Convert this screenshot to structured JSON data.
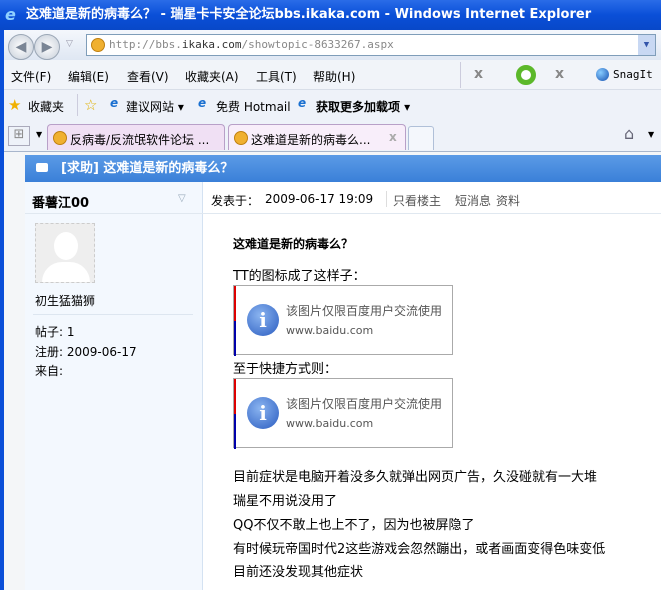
{
  "window": {
    "title": "这难道是新的病毒么？ - 瑞星卡卡安全论坛bbs.ikaka.com - Windows Internet Explorer"
  },
  "address": {
    "prefix": "http://bbs.",
    "domain": "ikaka.com",
    "path": "/showtopic-8633267.aspx"
  },
  "menu": [
    "文件(F)",
    "编辑(E)",
    "查看(V)",
    "收藏夹(A)",
    "工具(T)",
    "帮助(H)"
  ],
  "toolbar": {
    "close1": "x",
    "close2": "x",
    "snagit": "SnagIt"
  },
  "favorites": {
    "label": "收藏夹",
    "items": [
      "建议网站 ▾",
      "免费 Hotmail",
      "获取更多加载项 ▾"
    ]
  },
  "tabs": [
    {
      "label": "反病毒/反流氓软件论坛 ..."
    },
    {
      "label": "这难道是新的病毒么...",
      "close": "x"
    }
  ],
  "thread": {
    "title": "[求助] 这难道是新的病毒么？"
  },
  "author": {
    "name": "番薯江00",
    "rank": "初生猛猫狮",
    "posts": "帖子: 1",
    "registered": "注册: 2009-06-17",
    "from": "来自:"
  },
  "post": {
    "posted_label": "发表于：",
    "posted_time": "2009-06-17 19:09",
    "links": [
      "只看楼主",
      "短消息",
      "资料"
    ],
    "title": "这难道是新的病毒么？",
    "line1": "TT的图标成了这样子：",
    "line2": "至于快捷方式则：",
    "image_text": "该图片仅限百度用户交流使用",
    "image_url": "www.baidu.com",
    "lines": [
      "目前症状是电脑开着没多久就弹出网页广告，久没碰就有一大堆",
      "瑞星不用说没用了",
      "QQ不仅不敢上也上不了，因为也被屏隐了",
      "有时候玩帝国时代2这些游戏会忽然蹦出，或者画面变得色味变低",
      "目前还没发现其他症状"
    ]
  }
}
